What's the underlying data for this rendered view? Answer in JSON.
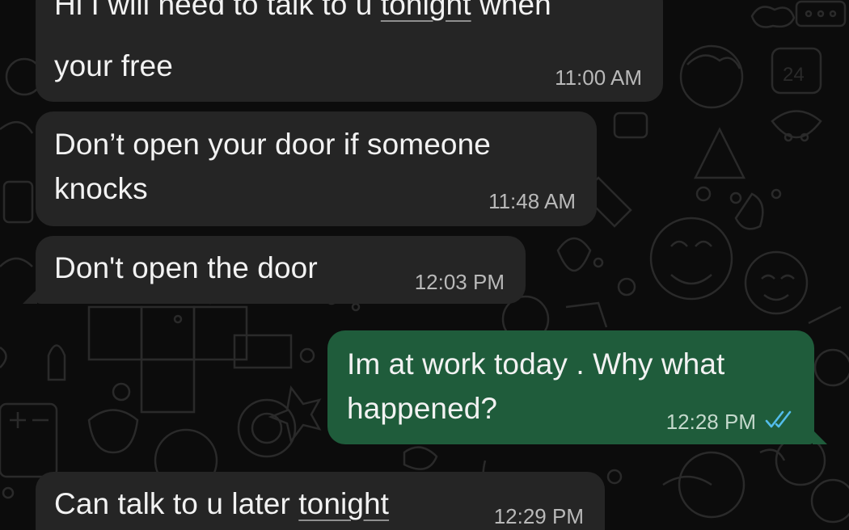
{
  "messages": [
    {
      "direction": "incoming",
      "line1_pre": "Hi I will need to talk to u ",
      "line1_link": "tonight",
      "line1_post": " when",
      "line2": "your free",
      "time": "11:00 AM"
    },
    {
      "direction": "incoming",
      "line1": "Don’t open your door if someone",
      "line2": "knocks",
      "time": "11:48 AM"
    },
    {
      "direction": "incoming",
      "line1": "Don't open the door",
      "time": "12:03 PM"
    },
    {
      "direction": "outgoing",
      "line1": "Im at work today . Why what",
      "line2": "happened?",
      "time": "12:28 PM",
      "status": "read"
    },
    {
      "direction": "incoming",
      "line1_pre": "Can talk to u later ",
      "line1_link": "tonight",
      "time": "12:29 PM"
    }
  ],
  "colors": {
    "background": "#0c0c0c",
    "incoming_bubble": "#252525",
    "outgoing_bubble": "#1f5c3b",
    "read_ticks": "#53bdeb"
  },
  "icons": [
    "double-check-icon"
  ]
}
